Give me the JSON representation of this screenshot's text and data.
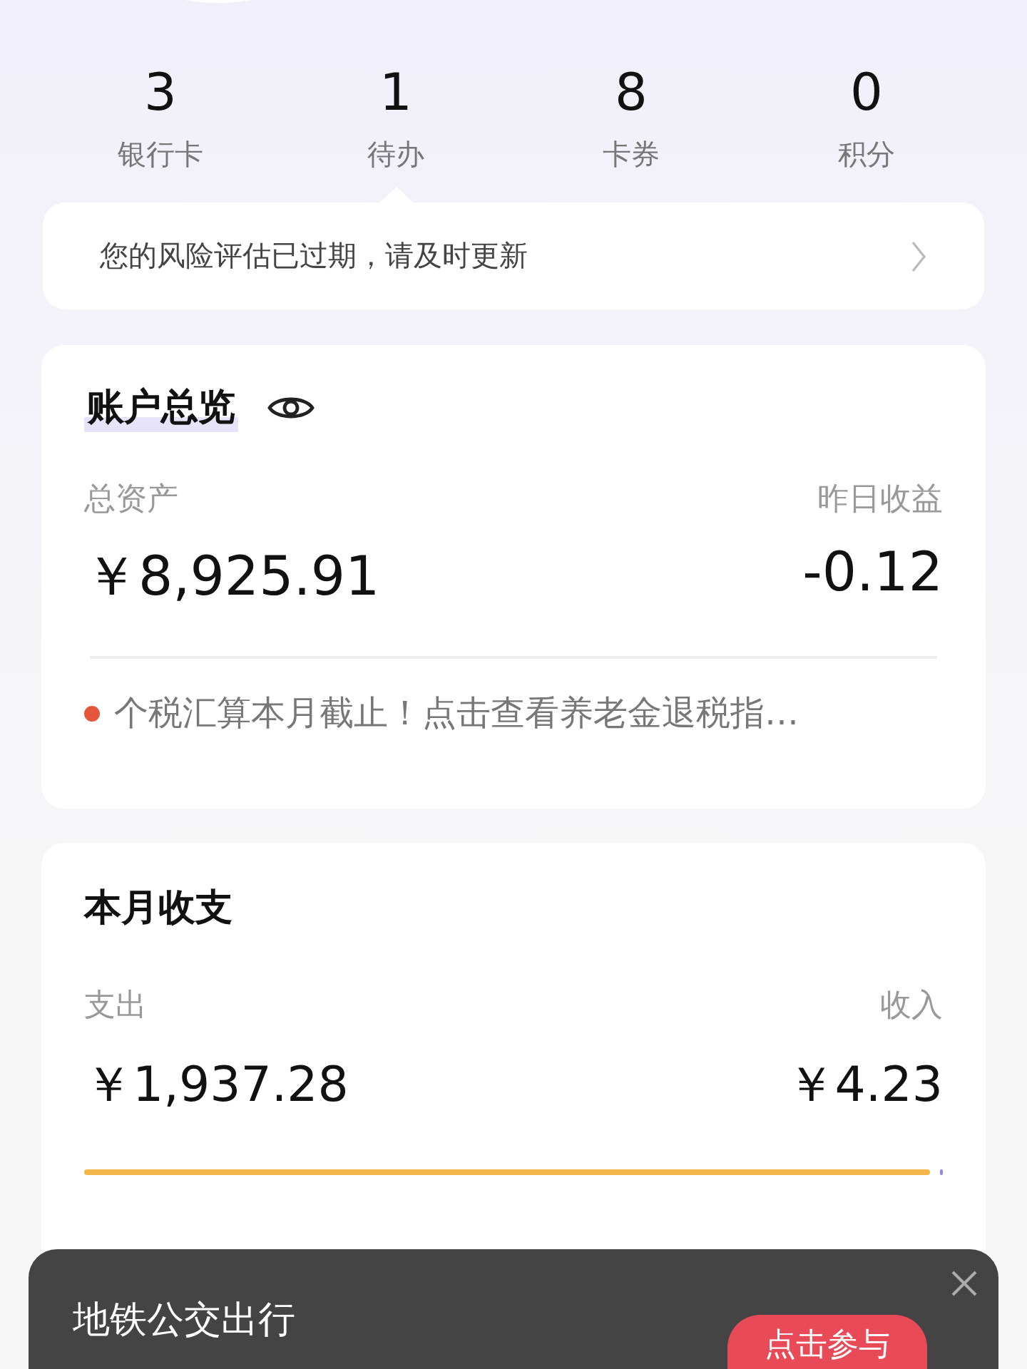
{
  "stats": [
    {
      "value": "3",
      "label": "银行卡"
    },
    {
      "value": "1",
      "label": "待办"
    },
    {
      "value": "8",
      "label": "卡券"
    },
    {
      "value": "0",
      "label": "积分"
    }
  ],
  "notice": {
    "text": "您的风险评估已过期，请及时更新"
  },
  "account": {
    "title": "账户总览",
    "left_label": "总资产",
    "left_value": "￥8,925.91",
    "right_label": "昨日收益",
    "right_value": "-0.12",
    "alert": {
      "text": "个税汇算本月截止！点击查看养老金退税指…",
      "color": "#e5553a"
    }
  },
  "monthly": {
    "title": "本月收支",
    "left_label": "支出",
    "left_value": "￥1,937.28",
    "right_label": "收入",
    "right_value": "￥4.23",
    "level": 0.985
  },
  "popup": {
    "title": "地铁公交出行",
    "button": "点击参与"
  }
}
